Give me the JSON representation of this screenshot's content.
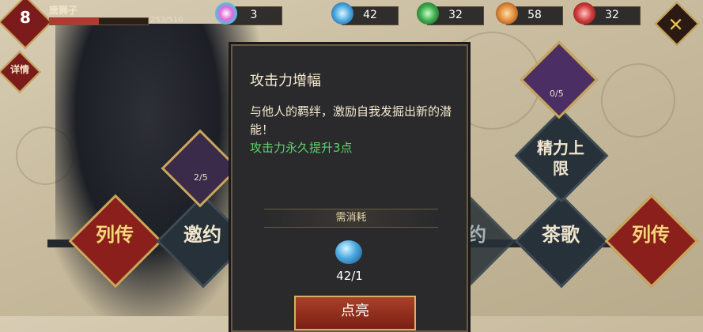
{
  "player": {
    "level": "8",
    "name": "唐狮子",
    "hp_text": "253/510",
    "hp_fraction": 0.496
  },
  "detail_button": "详情",
  "resources": [
    {
      "icon": "rainbow-orb-icon",
      "value": "3"
    },
    {
      "icon": "blue-crystal-icon",
      "value": "42"
    },
    {
      "icon": "green-jade-icon",
      "value": "32"
    },
    {
      "icon": "orange-leaf-icon",
      "value": "58"
    },
    {
      "icon": "red-gem-icon",
      "value": "32"
    }
  ],
  "popup": {
    "title": "攻击力增幅",
    "description": "与他人的羁绊，激励自我发掘出新的潜能！",
    "effect": "攻击力永久提升3点",
    "cost_header": "需消耗",
    "cost_amount": "42/1",
    "confirm_label": "点亮"
  },
  "nodes": {
    "left_progress": "2/5",
    "top_right_progress": "0/5",
    "left_red_1": "列传",
    "left_invite": "邀约",
    "center_tea": "茶歌",
    "center_col": "列传",
    "right_invite": "邀约",
    "right_tea": "茶歌",
    "right_red": "列传",
    "energy": "精力上限"
  },
  "colors": {
    "accent_gold": "#c9a65a",
    "effect_green": "#5bd36a",
    "node_red": "#8a1f1c"
  }
}
